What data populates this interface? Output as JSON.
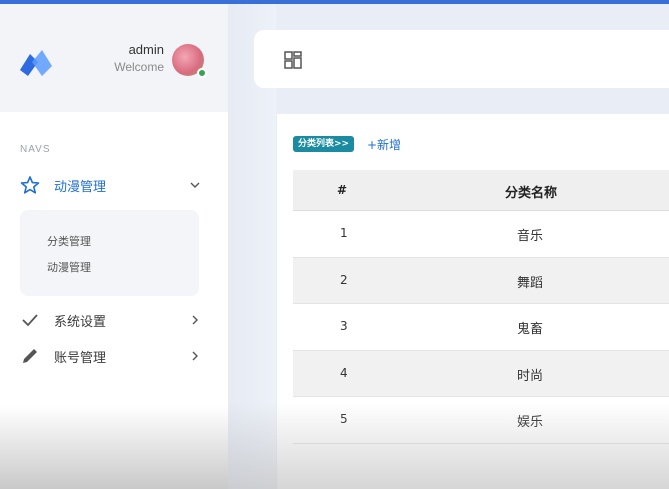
{
  "user": {
    "name": "admin",
    "subtitle": "Welcome"
  },
  "sidebar": {
    "section_label": "NAVS",
    "items": [
      {
        "label": "动漫管理",
        "icon": "star-icon",
        "expanded": true,
        "children": [
          "分类管理",
          "动漫管理"
        ]
      },
      {
        "label": "系统设置",
        "icon": "check-icon"
      },
      {
        "label": "账号管理",
        "icon": "pencil-icon"
      }
    ]
  },
  "header": {
    "menu_icon": "dashboard-icon"
  },
  "content": {
    "badge": "分类列表>>",
    "add_link": "+新增",
    "table": {
      "columns": [
        "#",
        "分类名称"
      ],
      "rows": [
        {
          "num": "1",
          "name": "音乐"
        },
        {
          "num": "2",
          "name": "舞蹈"
        },
        {
          "num": "3",
          "name": "鬼畜"
        },
        {
          "num": "4",
          "name": "时尚"
        },
        {
          "num": "5",
          "name": "娱乐"
        }
      ]
    }
  },
  "colors": {
    "accent": "#1f6fd3",
    "badge": "#1a8ba0",
    "online": "#3aa157"
  }
}
